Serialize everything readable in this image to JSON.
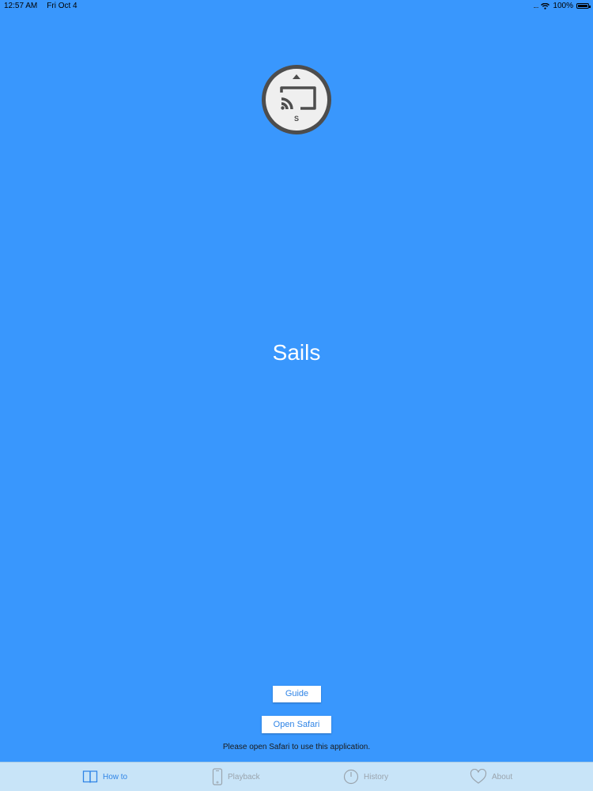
{
  "status_bar": {
    "time": "12:57 AM",
    "date": "Fri Oct 4",
    "battery_percent": "100%"
  },
  "logo": {
    "letter": "S"
  },
  "app": {
    "title": "Sails"
  },
  "buttons": {
    "guide": "Guide",
    "open_safari": "Open Safari"
  },
  "hint": "Please open Safari to use this application.",
  "tabs": [
    {
      "label": "How to",
      "icon": "book-icon",
      "active": true
    },
    {
      "label": "Playback",
      "icon": "phone-icon",
      "active": false
    },
    {
      "label": "History",
      "icon": "clock-icon",
      "active": false
    },
    {
      "label": "About",
      "icon": "heart-icon",
      "active": false
    }
  ],
  "colors": {
    "background": "#3997fd",
    "accent": "#2f84e6",
    "tab_bar": "#c8e4f8"
  }
}
